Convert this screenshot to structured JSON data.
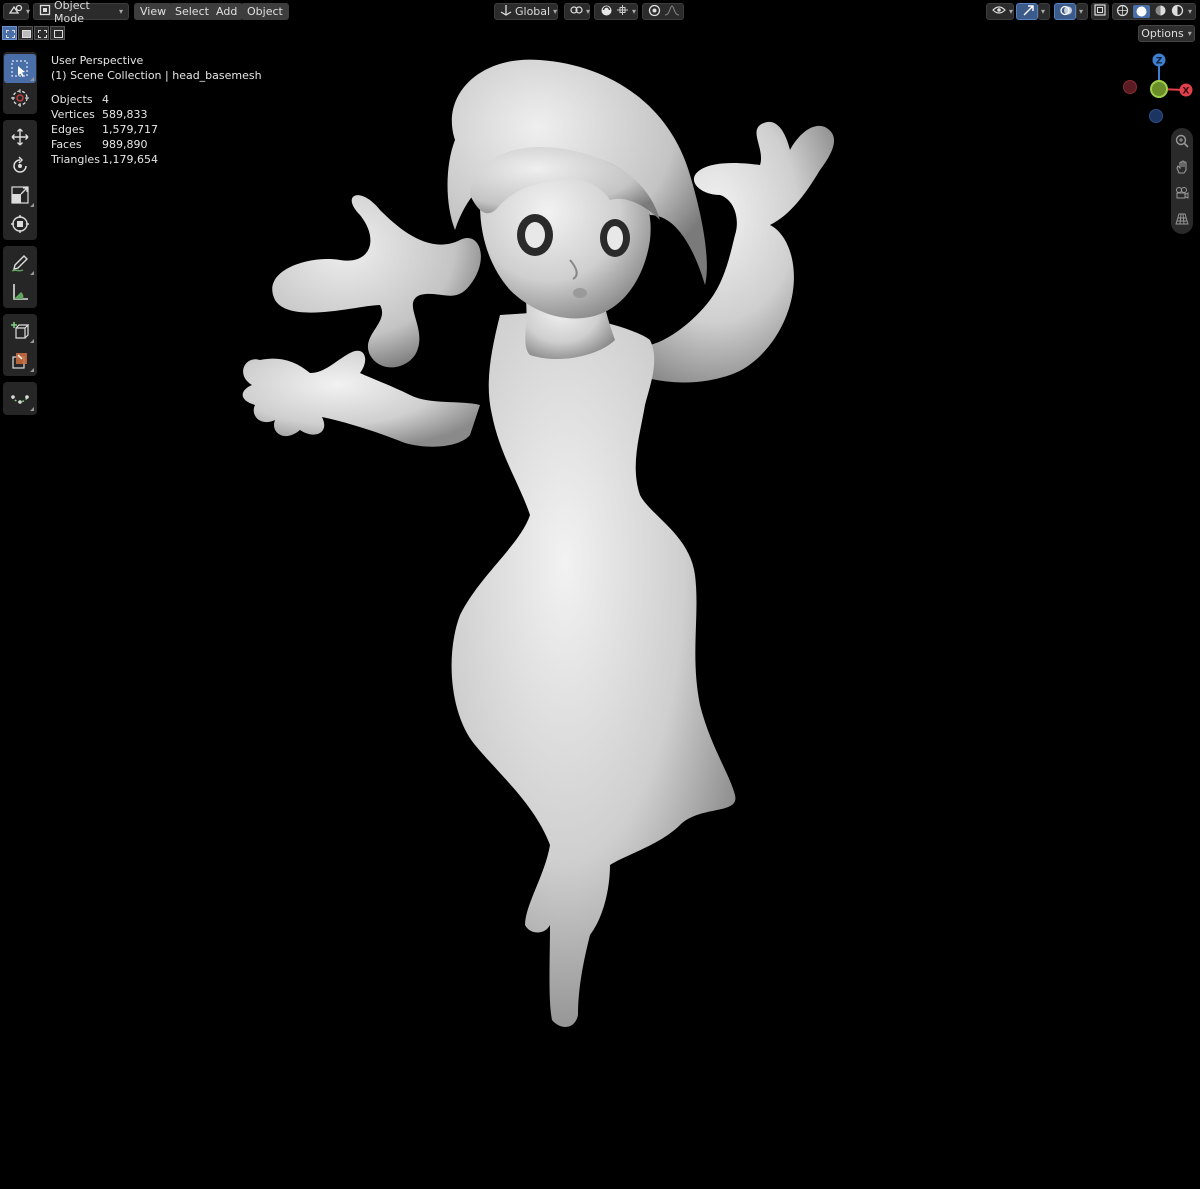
{
  "header": {
    "mode_label": "Object Mode",
    "menus": [
      "View",
      "Select",
      "Add",
      "Object"
    ],
    "orientation_label": "Global",
    "options_label": "Options"
  },
  "overlay": {
    "view_name": "User Perspective",
    "collection_line": "(1) Scene Collection | head_basemesh"
  },
  "stats": [
    {
      "label": "Objects",
      "value": "4"
    },
    {
      "label": "Vertices",
      "value": "589,833"
    },
    {
      "label": "Edges",
      "value": "1,579,717"
    },
    {
      "label": "Faces",
      "value": "989,890"
    },
    {
      "label": "Triangles",
      "value": "1,179,654"
    }
  ],
  "gizmo": {
    "z_label": "Z",
    "x_label": "X"
  },
  "colors": {
    "accent": "#4a6fa8",
    "x_axis": "#e0404a",
    "y_axis": "#8bc34a",
    "z_axis": "#3f7fd0",
    "model": "#d8d8d8"
  },
  "toolbar_tools": [
    "select-box",
    "cursor",
    "move",
    "rotate",
    "scale",
    "transform",
    "annotate",
    "measure",
    "add-cube",
    "extrude",
    "edge"
  ]
}
